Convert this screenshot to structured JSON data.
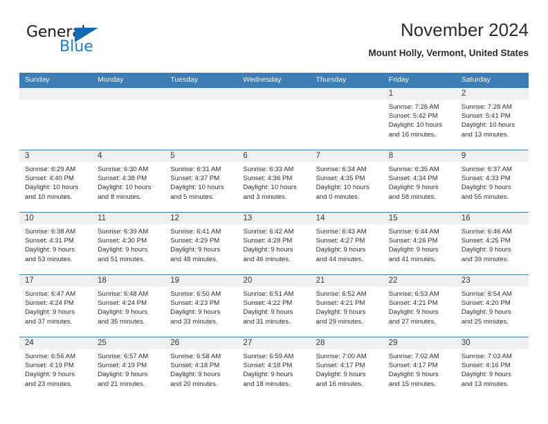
{
  "brand": {
    "name_part1": "General",
    "name_part2": "Blue",
    "logo_icon": "triangle-icon"
  },
  "header": {
    "title": "November 2024",
    "subtitle": "Mount Holly, Vermont, United States"
  },
  "colors": {
    "header_blue": "#3d7cb5",
    "row_band_gray": "#f0f0f0",
    "brand_blue": "#1e7fd0",
    "text": "#2e2e2e"
  },
  "calendar": {
    "weekday_headers": [
      "Sunday",
      "Monday",
      "Tuesday",
      "Wednesday",
      "Thursday",
      "Friday",
      "Saturday"
    ],
    "weeks": [
      [
        {
          "day": "",
          "sunrise": "",
          "sunset": "",
          "daylight_line1": "",
          "daylight_line2": ""
        },
        {
          "day": "",
          "sunrise": "",
          "sunset": "",
          "daylight_line1": "",
          "daylight_line2": ""
        },
        {
          "day": "",
          "sunrise": "",
          "sunset": "",
          "daylight_line1": "",
          "daylight_line2": ""
        },
        {
          "day": "",
          "sunrise": "",
          "sunset": "",
          "daylight_line1": "",
          "daylight_line2": ""
        },
        {
          "day": "",
          "sunrise": "",
          "sunset": "",
          "daylight_line1": "",
          "daylight_line2": ""
        },
        {
          "day": "1",
          "sunrise": "Sunrise: 7:26 AM",
          "sunset": "Sunset: 5:42 PM",
          "daylight_line1": "Daylight: 10 hours",
          "daylight_line2": "and 16 minutes."
        },
        {
          "day": "2",
          "sunrise": "Sunrise: 7:28 AM",
          "sunset": "Sunset: 5:41 PM",
          "daylight_line1": "Daylight: 10 hours",
          "daylight_line2": "and 13 minutes."
        }
      ],
      [
        {
          "day": "3",
          "sunrise": "Sunrise: 6:29 AM",
          "sunset": "Sunset: 4:40 PM",
          "daylight_line1": "Daylight: 10 hours",
          "daylight_line2": "and 10 minutes."
        },
        {
          "day": "4",
          "sunrise": "Sunrise: 6:30 AM",
          "sunset": "Sunset: 4:38 PM",
          "daylight_line1": "Daylight: 10 hours",
          "daylight_line2": "and 8 minutes."
        },
        {
          "day": "5",
          "sunrise": "Sunrise: 6:31 AM",
          "sunset": "Sunset: 4:37 PM",
          "daylight_line1": "Daylight: 10 hours",
          "daylight_line2": "and 5 minutes."
        },
        {
          "day": "6",
          "sunrise": "Sunrise: 6:33 AM",
          "sunset": "Sunset: 4:36 PM",
          "daylight_line1": "Daylight: 10 hours",
          "daylight_line2": "and 3 minutes."
        },
        {
          "day": "7",
          "sunrise": "Sunrise: 6:34 AM",
          "sunset": "Sunset: 4:35 PM",
          "daylight_line1": "Daylight: 10 hours",
          "daylight_line2": "and 0 minutes."
        },
        {
          "day": "8",
          "sunrise": "Sunrise: 6:35 AM",
          "sunset": "Sunset: 4:34 PM",
          "daylight_line1": "Daylight: 9 hours",
          "daylight_line2": "and 58 minutes."
        },
        {
          "day": "9",
          "sunrise": "Sunrise: 6:37 AM",
          "sunset": "Sunset: 4:33 PM",
          "daylight_line1": "Daylight: 9 hours",
          "daylight_line2": "and 55 minutes."
        }
      ],
      [
        {
          "day": "10",
          "sunrise": "Sunrise: 6:38 AM",
          "sunset": "Sunset: 4:31 PM",
          "daylight_line1": "Daylight: 9 hours",
          "daylight_line2": "and 53 minutes."
        },
        {
          "day": "11",
          "sunrise": "Sunrise: 6:39 AM",
          "sunset": "Sunset: 4:30 PM",
          "daylight_line1": "Daylight: 9 hours",
          "daylight_line2": "and 51 minutes."
        },
        {
          "day": "12",
          "sunrise": "Sunrise: 6:41 AM",
          "sunset": "Sunset: 4:29 PM",
          "daylight_line1": "Daylight: 9 hours",
          "daylight_line2": "and 48 minutes."
        },
        {
          "day": "13",
          "sunrise": "Sunrise: 6:42 AM",
          "sunset": "Sunset: 4:28 PM",
          "daylight_line1": "Daylight: 9 hours",
          "daylight_line2": "and 46 minutes."
        },
        {
          "day": "14",
          "sunrise": "Sunrise: 6:43 AM",
          "sunset": "Sunset: 4:27 PM",
          "daylight_line1": "Daylight: 9 hours",
          "daylight_line2": "and 44 minutes."
        },
        {
          "day": "15",
          "sunrise": "Sunrise: 6:44 AM",
          "sunset": "Sunset: 4:26 PM",
          "daylight_line1": "Daylight: 9 hours",
          "daylight_line2": "and 41 minutes."
        },
        {
          "day": "16",
          "sunrise": "Sunrise: 6:46 AM",
          "sunset": "Sunset: 4:25 PM",
          "daylight_line1": "Daylight: 9 hours",
          "daylight_line2": "and 39 minutes."
        }
      ],
      [
        {
          "day": "17",
          "sunrise": "Sunrise: 6:47 AM",
          "sunset": "Sunset: 4:24 PM",
          "daylight_line1": "Daylight: 9 hours",
          "daylight_line2": "and 37 minutes."
        },
        {
          "day": "18",
          "sunrise": "Sunrise: 6:48 AM",
          "sunset": "Sunset: 4:24 PM",
          "daylight_line1": "Daylight: 9 hours",
          "daylight_line2": "and 35 minutes."
        },
        {
          "day": "19",
          "sunrise": "Sunrise: 6:50 AM",
          "sunset": "Sunset: 4:23 PM",
          "daylight_line1": "Daylight: 9 hours",
          "daylight_line2": "and 33 minutes."
        },
        {
          "day": "20",
          "sunrise": "Sunrise: 6:51 AM",
          "sunset": "Sunset: 4:22 PM",
          "daylight_line1": "Daylight: 9 hours",
          "daylight_line2": "and 31 minutes."
        },
        {
          "day": "21",
          "sunrise": "Sunrise: 6:52 AM",
          "sunset": "Sunset: 4:21 PM",
          "daylight_line1": "Daylight: 9 hours",
          "daylight_line2": "and 29 minutes."
        },
        {
          "day": "22",
          "sunrise": "Sunrise: 6:53 AM",
          "sunset": "Sunset: 4:21 PM",
          "daylight_line1": "Daylight: 9 hours",
          "daylight_line2": "and 27 minutes."
        },
        {
          "day": "23",
          "sunrise": "Sunrise: 6:54 AM",
          "sunset": "Sunset: 4:20 PM",
          "daylight_line1": "Daylight: 9 hours",
          "daylight_line2": "and 25 minutes."
        }
      ],
      [
        {
          "day": "24",
          "sunrise": "Sunrise: 6:56 AM",
          "sunset": "Sunset: 4:19 PM",
          "daylight_line1": "Daylight: 9 hours",
          "daylight_line2": "and 23 minutes."
        },
        {
          "day": "25",
          "sunrise": "Sunrise: 6:57 AM",
          "sunset": "Sunset: 4:19 PM",
          "daylight_line1": "Daylight: 9 hours",
          "daylight_line2": "and 21 minutes."
        },
        {
          "day": "26",
          "sunrise": "Sunrise: 6:58 AM",
          "sunset": "Sunset: 4:18 PM",
          "daylight_line1": "Daylight: 9 hours",
          "daylight_line2": "and 20 minutes."
        },
        {
          "day": "27",
          "sunrise": "Sunrise: 6:59 AM",
          "sunset": "Sunset: 4:18 PM",
          "daylight_line1": "Daylight: 9 hours",
          "daylight_line2": "and 18 minutes."
        },
        {
          "day": "28",
          "sunrise": "Sunrise: 7:00 AM",
          "sunset": "Sunset: 4:17 PM",
          "daylight_line1": "Daylight: 9 hours",
          "daylight_line2": "and 16 minutes."
        },
        {
          "day": "29",
          "sunrise": "Sunrise: 7:02 AM",
          "sunset": "Sunset: 4:17 PM",
          "daylight_line1": "Daylight: 9 hours",
          "daylight_line2": "and 15 minutes."
        },
        {
          "day": "30",
          "sunrise": "Sunrise: 7:03 AM",
          "sunset": "Sunset: 4:16 PM",
          "daylight_line1": "Daylight: 9 hours",
          "daylight_line2": "and 13 minutes."
        }
      ]
    ]
  }
}
